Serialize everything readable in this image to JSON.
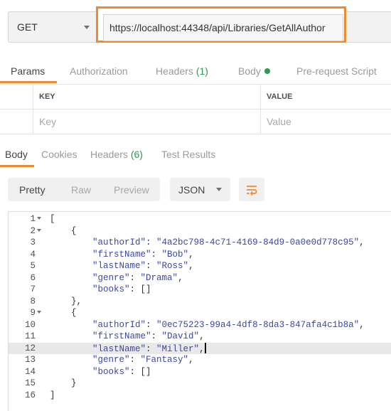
{
  "request": {
    "method": "GET",
    "url": "https://localhost:44348/api/Libraries/GetAllAuthor"
  },
  "request_tabs": {
    "params": "Params",
    "authorization": "Authorization",
    "headers": "Headers",
    "headers_count": "(1)",
    "body": "Body",
    "prerequest": "Pre-request Script"
  },
  "params_table": {
    "key_header": "KEY",
    "value_header": "VALUE",
    "key_placeholder": "Key",
    "value_placeholder": "Value"
  },
  "response_tabs": {
    "body": "Body",
    "cookies": "Cookies",
    "headers": "Headers",
    "headers_count": "(6)",
    "test_results": "Test Results"
  },
  "view": {
    "pretty": "Pretty",
    "raw": "Raw",
    "preview": "Preview",
    "format": "JSON"
  },
  "colors": {
    "accent": "#ef8a33",
    "green": "#2a9c4a",
    "json_key": "#3a48a3"
  },
  "code": {
    "highlighted_line": 12,
    "lines": [
      {
        "n": "1",
        "fold": true,
        "text": "["
      },
      {
        "n": "2",
        "fold": true,
        "text": "    {"
      },
      {
        "n": "3",
        "fold": false,
        "text": "        \"authorId\": \"4a2bc798-4c71-4169-84d9-0a0e0d778c95\","
      },
      {
        "n": "4",
        "fold": false,
        "text": "        \"firstName\": \"Bob\","
      },
      {
        "n": "5",
        "fold": false,
        "text": "        \"lastName\": \"Ross\","
      },
      {
        "n": "6",
        "fold": false,
        "text": "        \"genre\": \"Drama\","
      },
      {
        "n": "7",
        "fold": false,
        "text": "        \"books\": []"
      },
      {
        "n": "8",
        "fold": false,
        "text": "    },"
      },
      {
        "n": "9",
        "fold": true,
        "text": "    {"
      },
      {
        "n": "10",
        "fold": false,
        "text": "        \"authorId\": \"0ec75223-99a4-4df8-8da3-847afa4c1b8a\","
      },
      {
        "n": "11",
        "fold": false,
        "text": "        \"firstName\": \"David\","
      },
      {
        "n": "12",
        "fold": false,
        "text": "        \"lastName\": \"Miller\","
      },
      {
        "n": "13",
        "fold": false,
        "text": "        \"genre\": \"Fantasy\","
      },
      {
        "n": "14",
        "fold": false,
        "text": "        \"books\": []"
      },
      {
        "n": "15",
        "fold": false,
        "text": "    }"
      },
      {
        "n": "16",
        "fold": false,
        "text": "]"
      }
    ]
  }
}
